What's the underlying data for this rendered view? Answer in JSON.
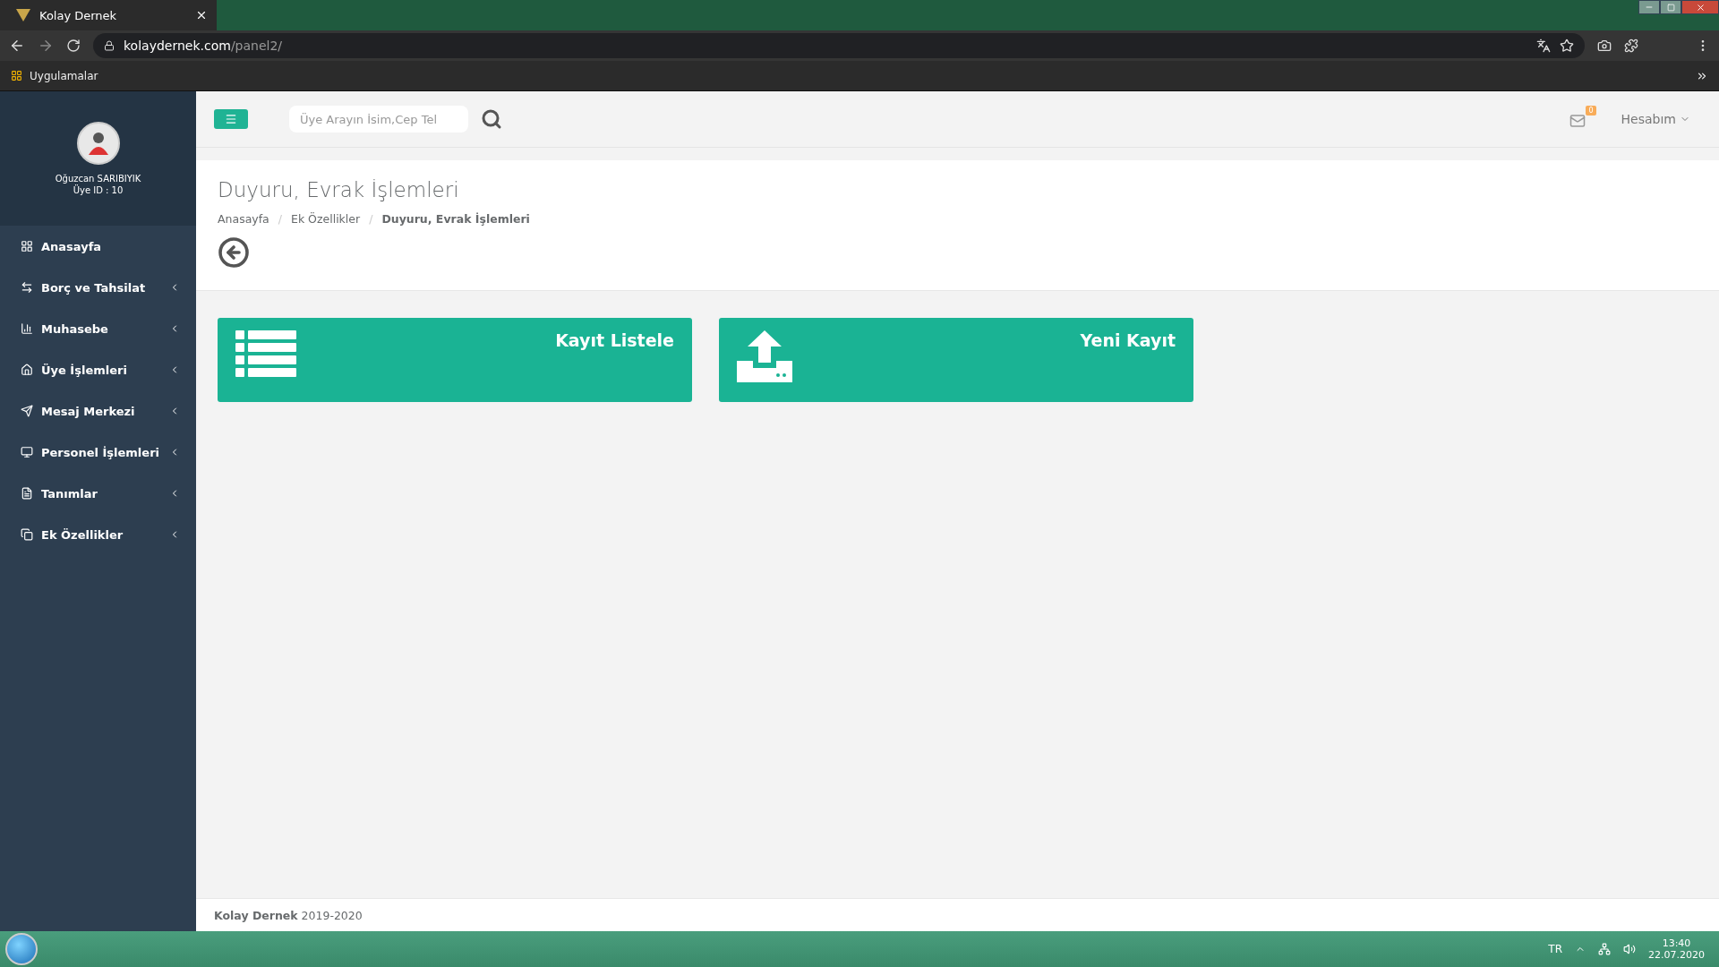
{
  "browser": {
    "tab_title": "Kolay Dernek",
    "url_host": "kolaydernek.com",
    "url_path": "/panel2/",
    "bookmarks": [
      "Uygulamalar"
    ]
  },
  "sidebar": {
    "user_name": "Oğuzcan SARIBIYIK",
    "user_id": "Üye ID : 10",
    "items": [
      {
        "label": "Anasayfa",
        "expandable": false
      },
      {
        "label": "Borç ve Tahsilat",
        "expandable": true
      },
      {
        "label": "Muhasebe",
        "expandable": true
      },
      {
        "label": "Üye İşlemleri",
        "expandable": true
      },
      {
        "label": "Mesaj Merkezi",
        "expandable": true
      },
      {
        "label": "Personel İşlemleri",
        "expandable": true
      },
      {
        "label": "Tanımlar",
        "expandable": true
      },
      {
        "label": "Ek Özellikler",
        "expandable": true
      }
    ]
  },
  "header": {
    "search": {
      "placeholder": "Üye Arayın İsim,Cep Tel"
    },
    "notification_count": "0",
    "account": "Hesabım"
  },
  "page": {
    "title": "Duyuru, Evrak İşlemleri",
    "breadcrumb_separator": "/",
    "breadcrumbs": [
      {
        "label": "Anasayfa",
        "current": false
      },
      {
        "label": "Ek Özellikler",
        "current": false
      },
      {
        "label": "Duyuru, Evrak İşlemleri",
        "current": true
      }
    ],
    "tiles": [
      {
        "label": "Kayıt Listele",
        "kind": "list"
      },
      {
        "label": "Yeni Kayıt",
        "kind": "upload"
      }
    ]
  },
  "footer": {
    "brand": "Kolay Dernek",
    "years": "2019-2020"
  },
  "taskbar": {
    "language": "TR",
    "time": "13:40",
    "date": "22.07.2020"
  }
}
